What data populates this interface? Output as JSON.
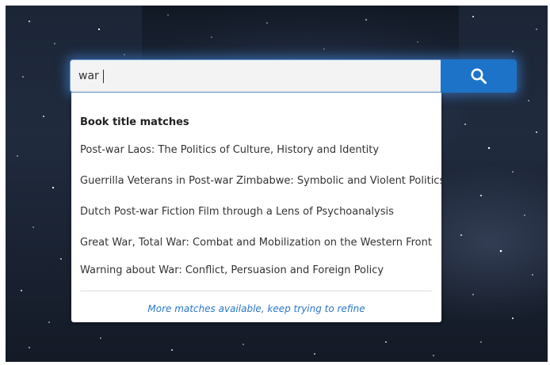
{
  "search": {
    "value": "war",
    "button_icon": "search-icon"
  },
  "dropdown": {
    "heading": "Book title matches",
    "results": [
      "Post-war Laos: The Politics of Culture, History and Identity",
      "Guerrilla Veterans in Post-war Zimbabwe: Symbolic and Violent Politics",
      "Dutch Post-war Fiction Film through a Lens of Psychoanalysis",
      "Great War, Total War: Combat and Mobilization on the Western Front",
      "Warning about War: Conflict, Persuasion and Foreign Policy"
    ],
    "more_text": "More matches available, keep trying to refine"
  },
  "colors": {
    "accent": "#1d73c8",
    "link": "#2a77c9",
    "input_bg": "#f3f3f3"
  }
}
